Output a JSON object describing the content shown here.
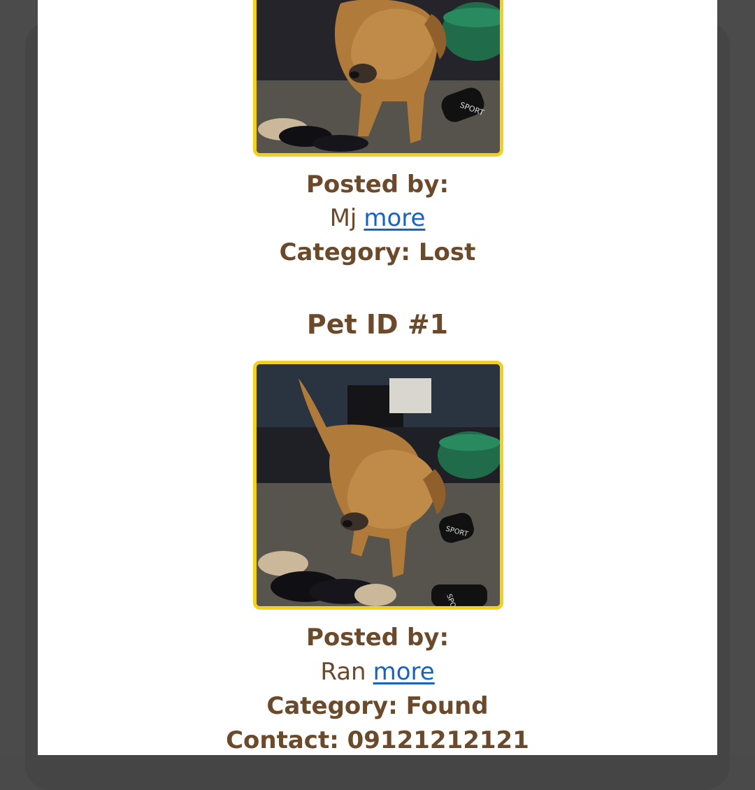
{
  "posts": [
    {
      "posted_by_label": "Posted by:",
      "author": "Mj",
      "more_label": "more",
      "category_line": "Category: Lost"
    },
    {
      "title": "Pet ID #1",
      "posted_by_label": "Posted by:",
      "author": "Ran",
      "more_label": "more",
      "category_line": "Category: Found",
      "contact_line": "Contact: 09121212121"
    }
  ],
  "colors": {
    "text": "#6b4a2b",
    "link": "#1565c0",
    "photo_border": "#f3d01a"
  }
}
